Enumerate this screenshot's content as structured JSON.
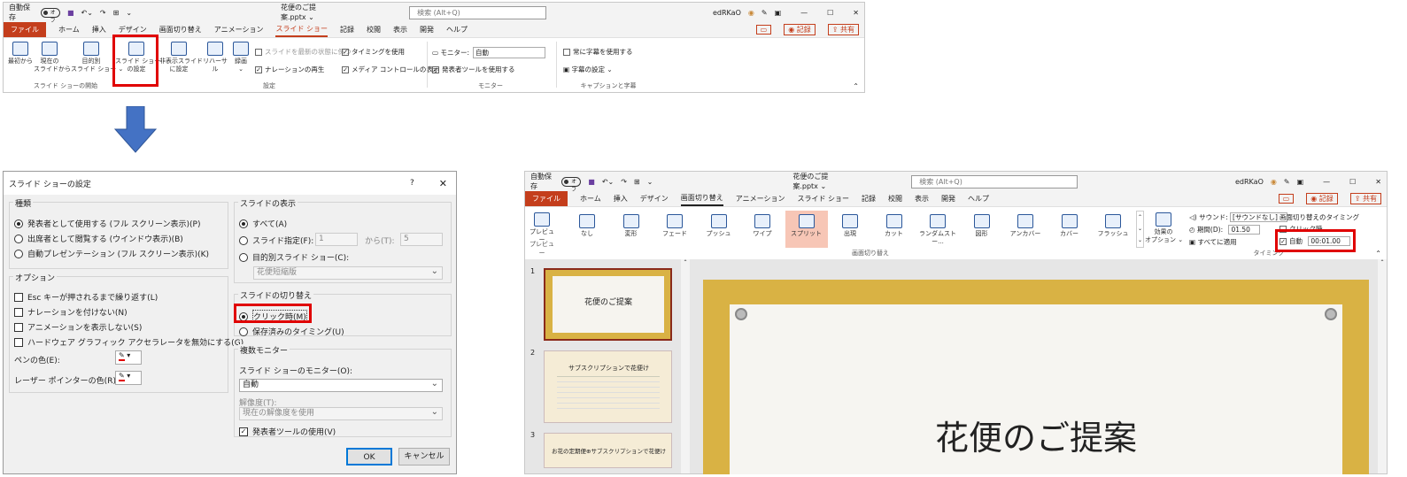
{
  "common": {
    "autosave": "自動保存",
    "autosave_state": "オフ",
    "search_placeholder": "検索 (Alt+Q)",
    "filename": "花便のご提案.pptx ⌄",
    "user": "edRKaO",
    "tabs": [
      "ファイル",
      "ホーム",
      "挿入",
      "デザイン",
      "画面切り替え",
      "アニメーション",
      "スライド ショー",
      "記録",
      "校閲",
      "表示",
      "開発",
      "ヘルプ"
    ],
    "record": "記録",
    "share": "共有"
  },
  "top_ribbon": {
    "buttons": [
      "最初から",
      "現在の\nスライドから",
      "目的別\nスライド ショー ⌄",
      "スライド ショー\nの設定",
      "非表示スライド\nに設定",
      "リハーサル",
      "録画\n⌄"
    ],
    "settings": {
      "keep_fresh": "スライドを最新の状態に保つ",
      "use_timings": "タイミングを使用",
      "play_narrations": "ナレーションの再生",
      "show_media": "メディア コントロールの表示"
    },
    "monitor_label": "モニター:",
    "monitor_value": "自動",
    "presenter_view": "発表者ツールを使用する",
    "always_subtitles": "常に字幕を使用する",
    "subtitle_settings": "字幕の設定 ⌄",
    "groups": [
      "スライド ショーの開始",
      "設定",
      "モニター",
      "キャプションと字幕"
    ]
  },
  "dialog": {
    "title": "スライド ショーの設定",
    "help": "?",
    "close": "✕",
    "type_heading": "種類",
    "type_options": [
      "発表者として使用する (フル スクリーン表示)(P)",
      "出席者として閲覧する (ウインドウ表示)(B)",
      "自動プレゼンテーション (フル スクリーン表示)(K)"
    ],
    "options_heading": "オプション",
    "options": [
      "Esc キーが押されるまで繰り返す(L)",
      "ナレーションを付けない(N)",
      "アニメーションを表示しない(S)",
      "ハードウェア グラフィック アクセラレータを無効にする(G)"
    ],
    "pen_color": "ペンの色(E):",
    "laser_color": "レーザー ポインターの色(R):",
    "slides_heading": "スライドの表示",
    "slides_all": "すべて(A)",
    "slides_range": "スライド指定(F):",
    "from_value": "1",
    "to_label": "から(T):",
    "to_value": "5",
    "custom_show": "目的別スライド ショー(C):",
    "custom_value": "花便短縮版",
    "advance_heading": "スライドの切り替え",
    "advance_manual": "クリック時(M)",
    "advance_timings": "保存済みのタイミング(U)",
    "multi_heading": "複数モニター",
    "monitor_label": "スライド ショーのモニター(O):",
    "monitor_value": "自動",
    "resolution_label": "解像度(T):",
    "resolution_value": "現在の解像度を使用",
    "presenter_view": "発表者ツールの使用(V)",
    "ok": "OK",
    "cancel": "キャンセル"
  },
  "right_ribbon": {
    "preview": "プレビュー",
    "effects": [
      "なし",
      "変形",
      "フェード",
      "プッシュ",
      "ワイプ",
      "スプリット",
      "出現",
      "カット",
      "ランダムストー...",
      "図形",
      "アンカバー",
      "カバー",
      "フラッシュ"
    ],
    "effect_options": "効果の\nオプション ⌄",
    "sound_label": "サウンド:",
    "sound_value": "[サウンドなし]",
    "duration_label": "期間(D):",
    "duration_value": "01.50",
    "apply_all": "すべてに適用",
    "timing_heading": "画面切り替えのタイミング",
    "on_click": "クリック時",
    "after_label": "自動",
    "after_value": "00:01.00",
    "groups": [
      "プレビュー",
      "画面切り替え",
      "タイミング"
    ]
  },
  "slides": {
    "numbers": [
      "1",
      "2",
      "3"
    ],
    "titles": [
      "花便のご提案",
      "サブスクリプションで花便け",
      "お花の定期便⊕サブスクリプションで花便け"
    ],
    "main_title": "花便のご提案"
  },
  "colors": {
    "accent": "#c43e1c",
    "highlight": "#e00000",
    "arrow": "#4472c4",
    "gold": "#d9b244"
  }
}
